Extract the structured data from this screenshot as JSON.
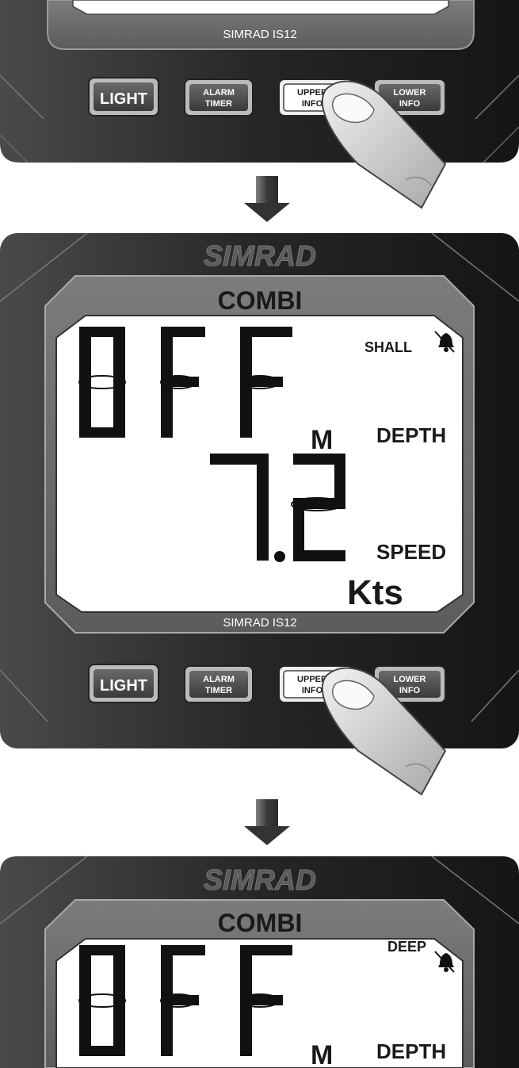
{
  "brand": {
    "logo": "SIMRAD",
    "model": "SIMRAD IS12"
  },
  "buttons": {
    "light": "LIGHT",
    "alarm_timer": [
      "ALARM",
      "TIMER"
    ],
    "upper_info": [
      "UPPER",
      "INFO"
    ],
    "lower_info": [
      "LOWER",
      "INFO"
    ]
  },
  "screen_2": {
    "title": "COMBI",
    "upper_value": "OFF",
    "alarm_label": "SHALL",
    "upper_unit": "M",
    "upper_label": "DEPTH",
    "lower_value": "7.2",
    "lower_label": "SPEED",
    "lower_unit": "Kts"
  },
  "screen_3": {
    "title": "COMBI",
    "upper_value": "OFF",
    "alarm_label": "DEEP",
    "upper_unit": "M",
    "upper_label": "DEPTH"
  },
  "colors": {
    "bezel": "#2c2c2c",
    "lcd": "#ffffff",
    "arrow": "#3a3a3a"
  }
}
